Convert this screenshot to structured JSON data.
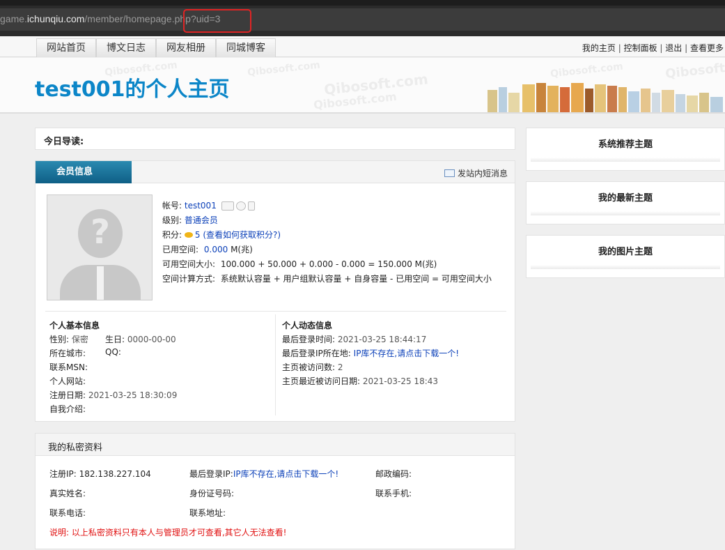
{
  "browser": {
    "url_prefix": "game.",
    "url_domain": "ichunqiu.com",
    "url_path": "/member/homepage.php",
    "url_query": "?uid=3"
  },
  "nav": {
    "tabs": [
      "网站首页",
      "博文日志",
      "网友相册",
      "同城博客"
    ],
    "links": [
      "我的主页",
      "控制面板",
      "退出",
      "查看更多"
    ]
  },
  "banner": {
    "title": "test001的个人主页",
    "watermark": "Qibosoft.com"
  },
  "today": {
    "label": "今日导读:"
  },
  "member": {
    "header": "会员信息",
    "message_link": "发站内短消息",
    "account_label": "帐号:",
    "account_value": "test001",
    "level_label": "级别:",
    "level_value": "普通会员",
    "points_label": "积分:",
    "points_value": "5",
    "points_link": "(查看如何获取积分?)",
    "used_label": "已用空间:",
    "used_value": "0.000",
    "used_unit": "M(兆)",
    "avail_label": "可用空间大小:",
    "avail_value": "100.000 + 50.000 + 0.000 - 0.000 = 150.000 M(兆)",
    "calc_label": "空间计算方式:",
    "calc_value": "系统默认容量 + 用户组默认容量 + 自身容量 - 已用空间 = 可用空间大小",
    "basic": {
      "title": "个人基本信息",
      "gender_label": "性别:",
      "gender_value": "保密",
      "birthday_label": "生日:",
      "birthday_value": "0000-00-00",
      "city_label": "所在城市:",
      "qq_label": "QQ:",
      "msn_label": "联系MSN:",
      "site_label": "个人网站:",
      "reg_label": "注册日期:",
      "reg_value": "2021-03-25 18:30:09",
      "intro_label": "自我介绍:"
    },
    "activity": {
      "title": "个人动态信息",
      "last_login_label": "最后登录时间:",
      "last_login_value": "2021-03-25 18:44:17",
      "last_ip_label": "最后登录IP所在地:",
      "last_ip_value": "IP库不存在,请点击下载一个!",
      "visits_label": "主页被访问数:",
      "visits_value": "2",
      "last_visit_label": "主页最近被访问日期:",
      "last_visit_value": "2021-03-25 18:43"
    }
  },
  "private": {
    "header": "我的私密资料",
    "reg_ip_label": "注册IP:",
    "reg_ip_value": "182.138.227.104",
    "last_ip_label": "最后登录IP:",
    "last_ip_value": "IP库不存在,请点击下载一个!",
    "zip_label": "邮政编码:",
    "name_label": "真实姓名:",
    "id_label": "身份证号码:",
    "mobile_label": "联系手机:",
    "phone_label": "联系电话:",
    "address_label": "联系地址:",
    "note": "说明: 以上私密资料只有本人与管理员才可查看,其它人无法查看!"
  },
  "sidebar": {
    "panels": [
      "系统推荐主题",
      "我的最新主题",
      "我的图片主题"
    ]
  }
}
